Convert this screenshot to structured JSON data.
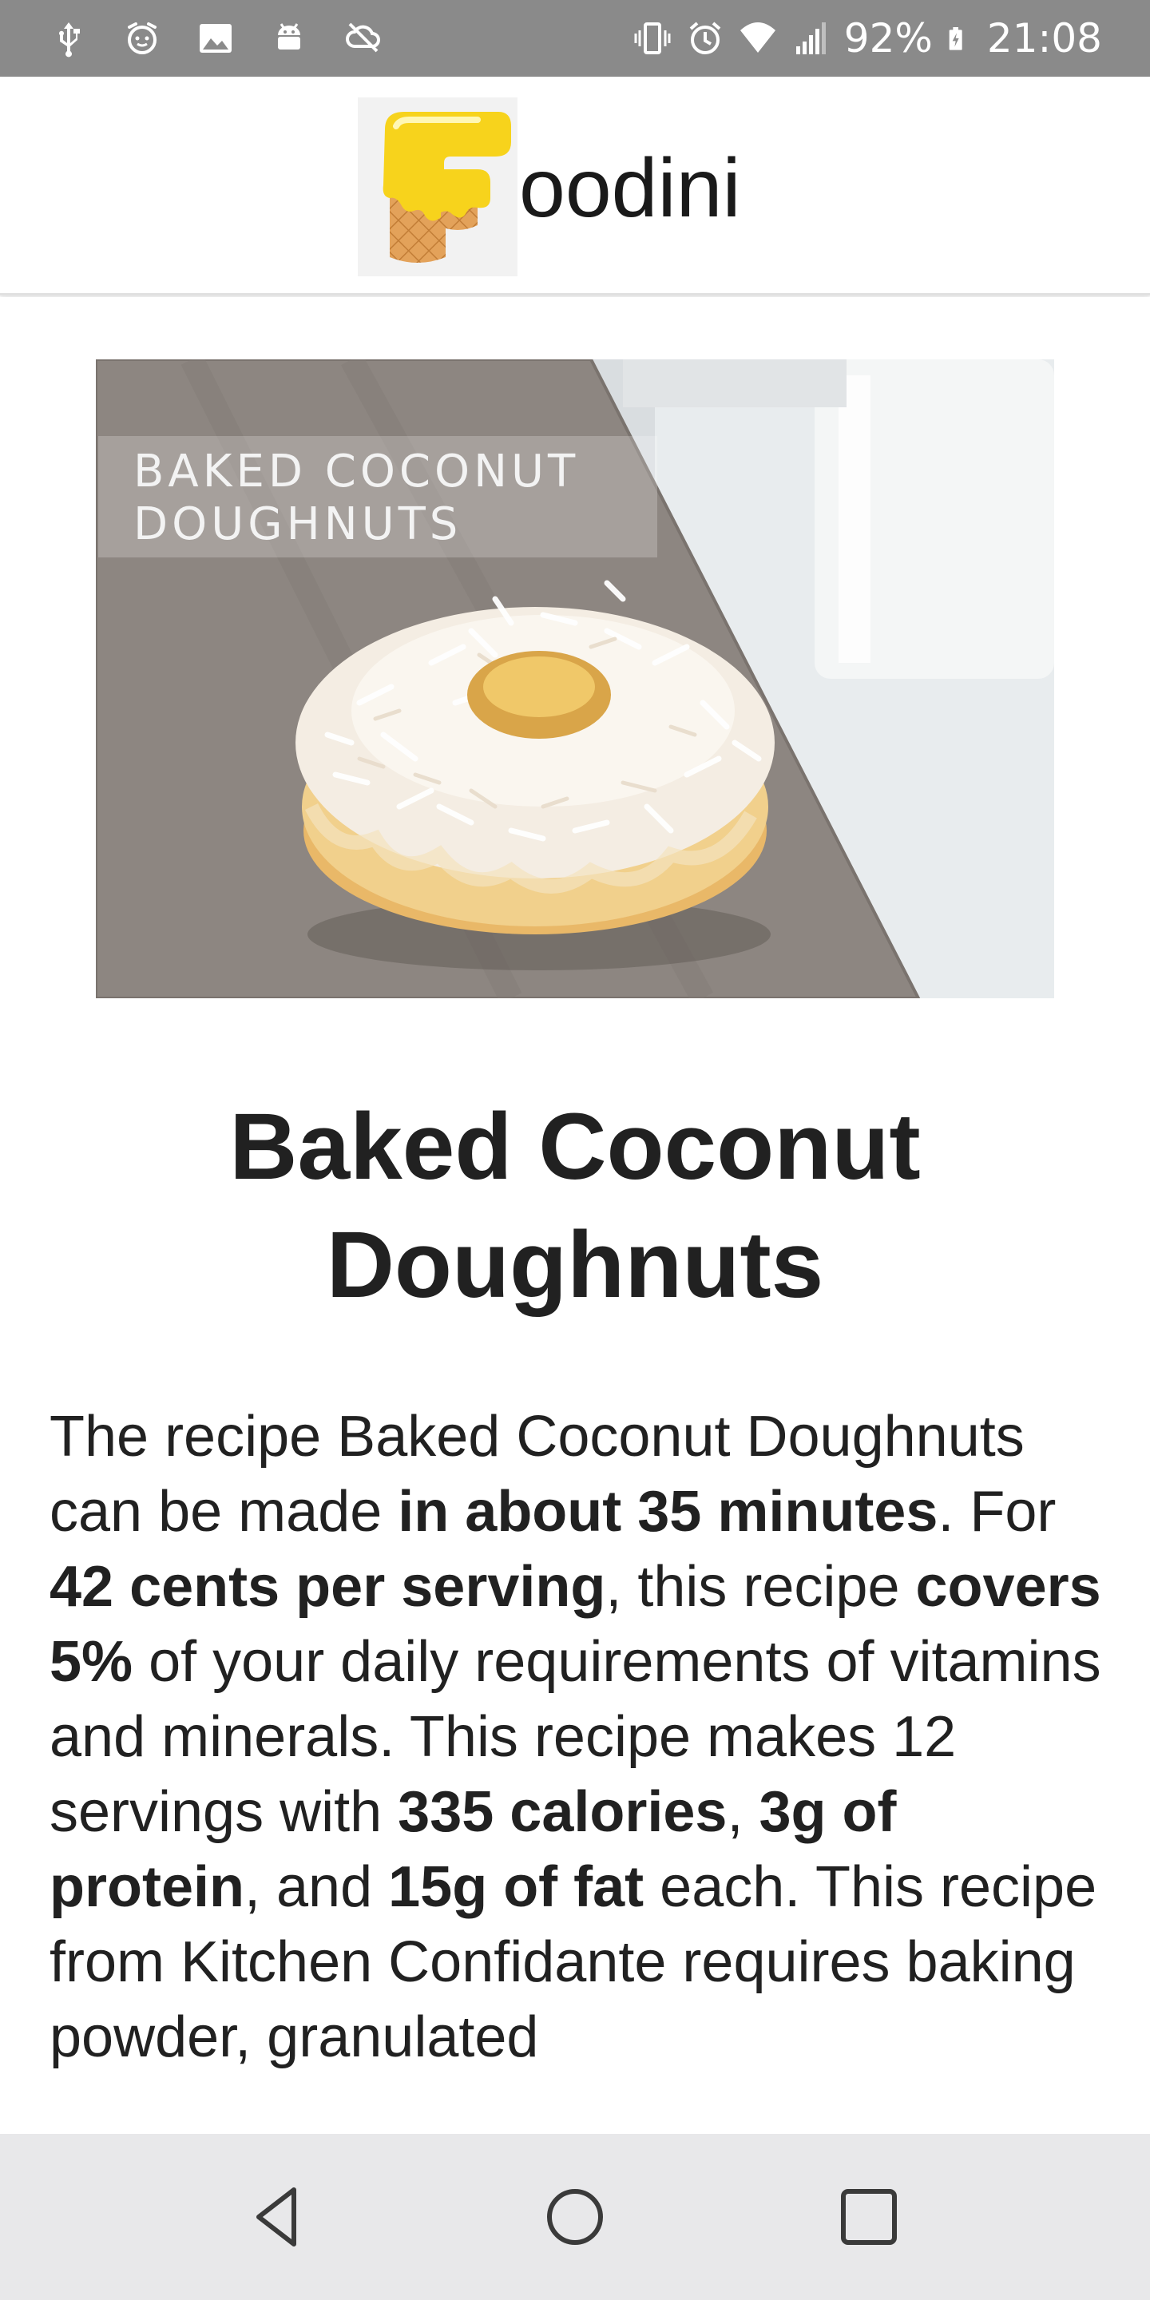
{
  "status_bar": {
    "battery": "92%",
    "time": "21:08",
    "left_icons": [
      "usb-icon",
      "face-icon",
      "image-icon",
      "android-icon",
      "no-sync-icon"
    ],
    "right_icons": [
      "vibrate-icon",
      "alarm-icon",
      "wifi-icon",
      "signal-icon",
      "battery-charging-icon"
    ]
  },
  "app_bar": {
    "logo_text": "oodini",
    "logo_icon": "foodini-f-logo-icon"
  },
  "recipe": {
    "image_caption_line1": "BAKED COCONUT",
    "image_caption_line2": "DOUGHNUTS",
    "title": "Baked Coconut Doughnuts",
    "summary": {
      "p1": "The recipe Baked Coconut Doughnuts can be made ",
      "b1": "in about 35 minutes",
      "p2": ". For ",
      "b2": "42 cents per serving",
      "p3": ", this recipe ",
      "b3": "covers 5%",
      "p4": " of your daily requirements of vitamins and minerals. This recipe makes 12 servings with ",
      "b4": "335 calories",
      "p5": ", ",
      "b5": "3g of protein",
      "p6": ", and ",
      "b6": "15g of fat",
      "p7": " each. This recipe from Kitchen Confidante requires baking powder, granulated"
    }
  },
  "nav_bar": {
    "buttons": [
      "back-icon",
      "home-icon",
      "recents-icon"
    ]
  },
  "colors": {
    "status_bar": "#8a8a8a",
    "nav_bar": "#e8e8ea",
    "text": "#212121",
    "logo_yellow": "#f7d31c",
    "logo_waffle": "#e3a25a"
  }
}
